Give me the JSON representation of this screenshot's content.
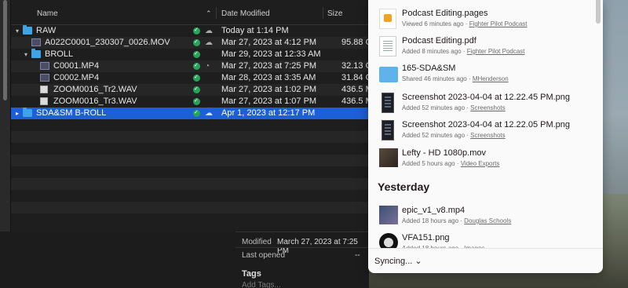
{
  "finder": {
    "columns": {
      "name": "Name",
      "date": "Date Modified",
      "size": "Size"
    },
    "rows": [
      {
        "name": "RAW",
        "date": "Today at 1:14 PM",
        "size": "",
        "kind": "folder",
        "depth": 0,
        "expanded": true,
        "state_icon": "cloud-download-icon"
      },
      {
        "name": "A022C0001_230307_0026.MOV",
        "date": "Mar 27, 2023 at 4:12 PM",
        "size": "95.88 G",
        "kind": "movie",
        "depth": 1,
        "state_icon": "cloud-download-icon"
      },
      {
        "name": "BROLL",
        "date": "Mar 29, 2023 at 12:33 AM",
        "size": "",
        "kind": "folder",
        "depth": 1,
        "expanded": true,
        "state_icon": ""
      },
      {
        "name": "C0001.MP4",
        "date": "Mar 27, 2023 at 7:25 PM",
        "size": "32.13 G",
        "kind": "movie",
        "depth": 2,
        "state_icon": "syncing-icon"
      },
      {
        "name": "C0002.MP4",
        "date": "Mar 28, 2023 at 3:35 AM",
        "size": "31.84 G",
        "kind": "movie",
        "depth": 2,
        "state_icon": ""
      },
      {
        "name": "ZOOM0016_Tr2.WAV",
        "date": "Mar 27, 2023 at 1:02 PM",
        "size": "436.5 M",
        "kind": "audio",
        "depth": 2,
        "state_icon": ""
      },
      {
        "name": "ZOOM0016_Tr3.WAV",
        "date": "Mar 27, 2023 at 1:07 PM",
        "size": "436.5 M",
        "kind": "audio",
        "depth": 2,
        "state_icon": ""
      },
      {
        "name": "SDA&SM B-ROLL",
        "date": "Apr 1, 2023 at 12:17 PM",
        "size": "",
        "kind": "folder",
        "depth": 0,
        "expanded": false,
        "selected": true,
        "state_icon": "cloud-icon"
      }
    ]
  },
  "info": {
    "modified_label": "Modified",
    "modified_value": "March 27, 2023 at 7:25 PM",
    "last_opened_label": "Last opened",
    "last_opened_value": "--",
    "tags_label": "Tags",
    "add_tags_placeholder": "Add Tags..."
  },
  "dropbox": {
    "items": [
      {
        "title": "Podcast Editing.pages",
        "meta": "Viewed 6 minutes ago · ",
        "link": "Fighter Pilot Podcast",
        "thumb": "pages"
      },
      {
        "title": "Podcast Editing.pdf",
        "meta": "Added 8 minutes ago · ",
        "link": "Fighter Pilot Podcast",
        "thumb": "pdf"
      },
      {
        "title": "165-SDA&SM",
        "meta": "Shared 46 minutes ago · ",
        "link": "MHenderson",
        "thumb": "folder"
      },
      {
        "title": "Screenshot 2023-04-04 at 12.22.45 PM.png",
        "meta": "Added 52 minutes ago · ",
        "link": "Screenshots",
        "thumb": "shot"
      },
      {
        "title": "Screenshot 2023-04-04 at 12.22.05 PM.png",
        "meta": "Added 52 minutes ago · ",
        "link": "Screenshots",
        "thumb": "shot"
      },
      {
        "title": "Lefty - HD 1080p.mov",
        "meta": "Added 5 hours ago · ",
        "link": "Video Exports",
        "thumb": "video"
      }
    ],
    "section_yesterday": "Yesterday",
    "yesterday_items": [
      {
        "title": "epic_v1_v8.mp4",
        "meta": "Added 18 hours ago · ",
        "link": "Douglas Schools",
        "thumb": "epic"
      },
      {
        "title": "VFA151.png",
        "meta": "Added 18 hours ago · ",
        "link": "Images",
        "thumb": "vfa"
      }
    ],
    "footer_status": "Syncing... ⌄"
  }
}
